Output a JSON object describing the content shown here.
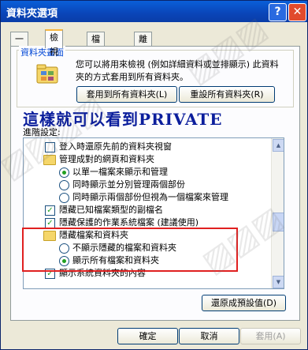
{
  "window": {
    "title": "資料夾選項",
    "help_glyph": "?",
    "close_glyph": "✕"
  },
  "tabs": [
    {
      "label": "一般",
      "active": false
    },
    {
      "label": "檢視",
      "active": true
    },
    {
      "label": "檔案類型",
      "active": false
    },
    {
      "label": "離線檔案",
      "active": false
    }
  ],
  "folder_views": {
    "label": "資料夾畫面",
    "description": "您可以將用來檢視 (例如詳細資料或並排顯示) 此資料夾的方式套用到所有資料夾。",
    "apply_all": "套用到所有資料夾(L)",
    "reset_all": "重設所有資料夾(R)"
  },
  "banner": "這樣就可以看到PRIVATE",
  "advanced_label": "進階設定:",
  "tree": [
    {
      "kind": "checkbox",
      "checked": false,
      "indent": 1,
      "label": "登入時還原先前的資料夾視窗"
    },
    {
      "kind": "folder",
      "indent": 1,
      "label": "管理成對的網頁和資料夾"
    },
    {
      "kind": "radio",
      "checked": true,
      "indent": 2,
      "label": "以單一檔案來顯示和管理"
    },
    {
      "kind": "radio",
      "checked": false,
      "indent": 2,
      "label": "同時顯示並分別管理兩個部份"
    },
    {
      "kind": "radio",
      "checked": false,
      "indent": 2,
      "label": "同時顯示兩個部份但視為一個檔案來管理"
    },
    {
      "kind": "checkbox",
      "checked": true,
      "indent": 1,
      "label": "隱藏已知檔案類型的副檔名"
    },
    {
      "kind": "checkbox",
      "checked": true,
      "indent": 1,
      "label": "隱藏保護的作業系統檔案 (建議使用)"
    },
    {
      "kind": "folder",
      "indent": 1,
      "label": "隱藏檔案和資料夾"
    },
    {
      "kind": "radio",
      "checked": false,
      "indent": 2,
      "label": "不顯示隱藏的檔案和資料夾"
    },
    {
      "kind": "radio",
      "checked": true,
      "indent": 2,
      "label": "顯示所有檔案和資料夾"
    },
    {
      "kind": "checkbox",
      "checked": true,
      "indent": 1,
      "label": "顯示系統資料夾的內容"
    }
  ],
  "restore_defaults": "還原成預設值(D)",
  "footer": {
    "ok": "確定",
    "cancel": "取消",
    "apply": "套用(A)"
  },
  "colors": {
    "title_bar": "#0a45b8",
    "banner": "#0b1e9c",
    "highlight_box": "#e02020",
    "check": "#21a121"
  }
}
